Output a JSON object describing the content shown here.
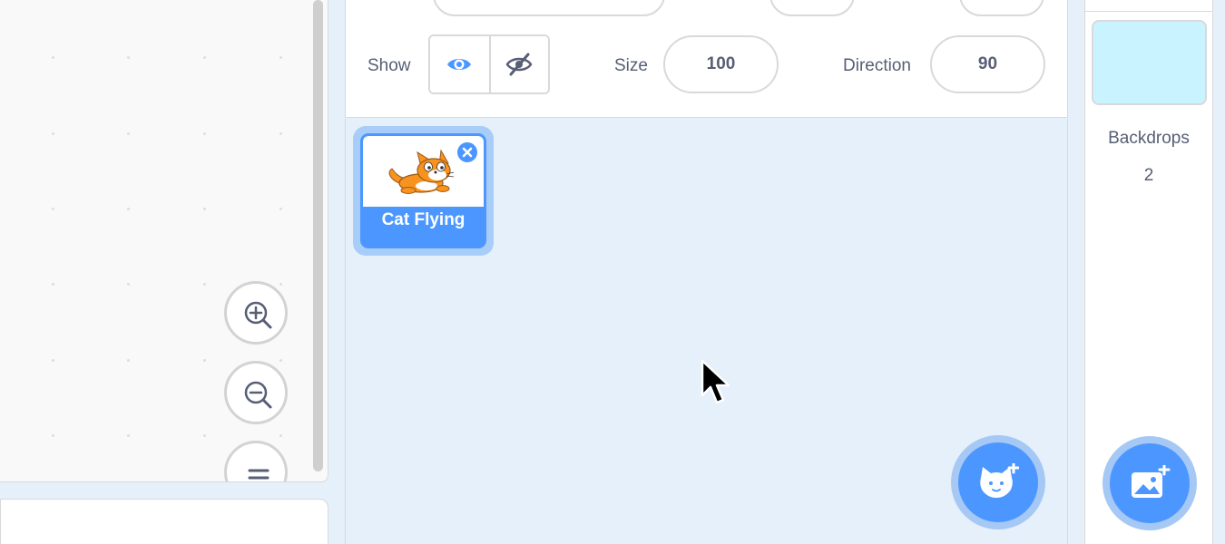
{
  "sprite_info": {
    "show_label": "Show",
    "size_label": "Size",
    "size_value": "100",
    "direction_label": "Direction",
    "direction_value": "90"
  },
  "sprites": [
    {
      "name": "Cat Flying",
      "selected": true
    }
  ],
  "stage": {
    "backdrops_label": "Backdrops",
    "backdrops_count": "2",
    "backdrop_color": "#c9f4ff"
  },
  "colors": {
    "accent": "#4c97ff",
    "workspace_bg": "#f9f9f9",
    "sprite_area_bg": "#e5f0fb"
  },
  "icons": {
    "zoom_in": "zoom-in-icon",
    "zoom_out": "zoom-out-icon",
    "zoom_reset": "zoom-reset-icon",
    "show": "eye-icon",
    "hide": "eye-slash-icon",
    "delete": "close-icon",
    "choose_sprite": "cat-plus-icon",
    "choose_backdrop": "image-plus-icon"
  }
}
